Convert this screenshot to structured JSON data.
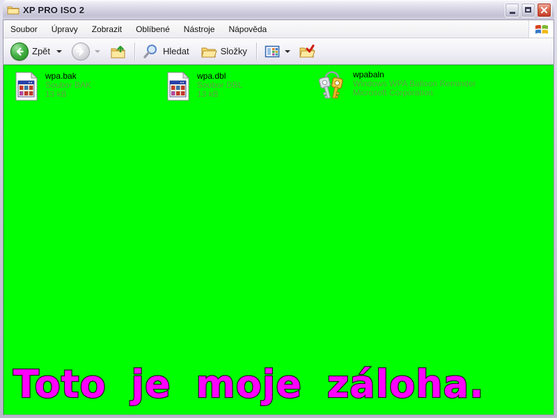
{
  "window": {
    "title": "XP PRO ISO 2"
  },
  "menu": {
    "items": [
      "Soubor",
      "Úpravy",
      "Zobrazit",
      "Oblíbené",
      "Nástroje",
      "Nápověda"
    ]
  },
  "toolbar": {
    "back_label": "Zpět",
    "search_label": "Hledat",
    "folders_label": "Složky"
  },
  "files": [
    {
      "name": "wpa.bak",
      "line1": "Soubor BAK",
      "line2": "13 kB"
    },
    {
      "name": "wpa.dbl",
      "line1": "Soubor DBL",
      "line2": "13 kB"
    },
    {
      "name": "wpabaln",
      "line1": "Windows WPA Balloon Reminder",
      "line2": "Microsoft Corporation"
    }
  ],
  "caption": {
    "text": "Toto je moje záloha."
  },
  "colors": {
    "content_bg": "#00ff00",
    "caption_text": "#ff00ff",
    "back_button": "#2f9e2f",
    "close_button": "#c23a24",
    "secondary_text": "#5da246"
  }
}
